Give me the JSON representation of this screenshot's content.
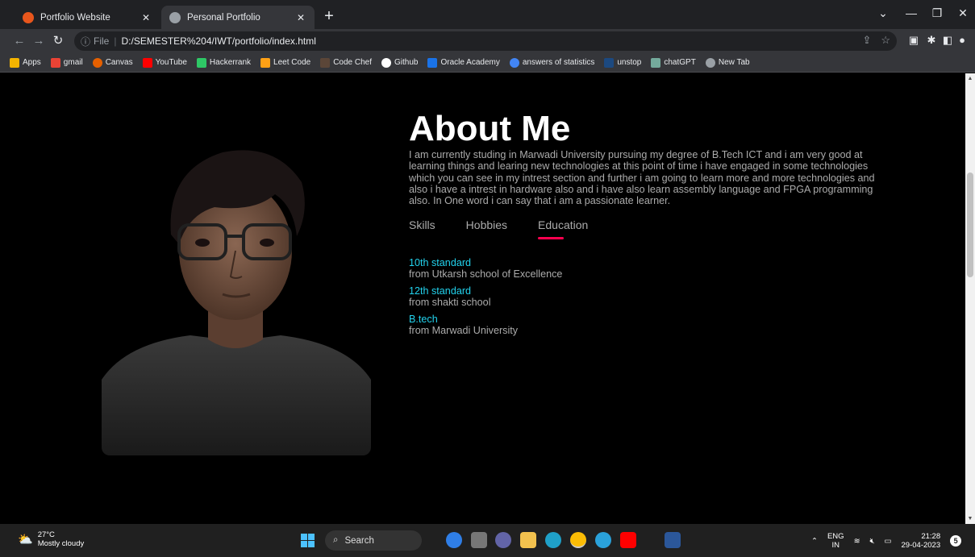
{
  "browser": {
    "tabs": [
      {
        "label": "Portfolio Website",
        "active": false
      },
      {
        "label": "Personal Portfolio",
        "active": true
      }
    ],
    "address": {
      "scheme_label": "File",
      "url": "D:/SEMESTER%204/IWT/portfolio/index.html"
    },
    "bookmarks": [
      {
        "label": "Apps",
        "color": "#f4b400"
      },
      {
        "label": "gmail",
        "color": "#ea4335"
      },
      {
        "label": "Canvas",
        "color": "#e66000"
      },
      {
        "label": "YouTube",
        "color": "#ff0000"
      },
      {
        "label": "Hackerrank",
        "color": "#2ec866"
      },
      {
        "label": "Leet Code",
        "color": "#ffa116"
      },
      {
        "label": "Code Chef",
        "color": "#5b4638"
      },
      {
        "label": "Github",
        "color": "#ffffff"
      },
      {
        "label": "Oracle Academy",
        "color": "#1a73e8"
      },
      {
        "label": "answers of statistics",
        "color": "#4285f4"
      },
      {
        "label": "unstop",
        "color": "#1c4980"
      },
      {
        "label": "chatGPT",
        "color": "#74aa9c"
      },
      {
        "label": "New Tab",
        "color": "#9aa0a6"
      }
    ]
  },
  "page": {
    "title": "About Me",
    "description": "I am currently studing in Marwadi University pursuing my degree of B.Tech ICT and i am very good at learning things and learing new technologies at this point of time i have engaged in some technologies which you can see in my intrest section and further i am going to learn more and more technologies and also i have a intrest in hardware also and i have also learn assembly language and FPGA programming also. In One word i can say that i am a passionate learner.",
    "tabs": [
      {
        "label": "Skills",
        "active": false
      },
      {
        "label": "Hobbies",
        "active": false
      },
      {
        "label": "Education",
        "active": true
      }
    ],
    "education": [
      {
        "title": "10th standard",
        "sub": "from Utkarsh school of Excellence"
      },
      {
        "title": "12th standard",
        "sub": "from shakti school"
      },
      {
        "title": "B.tech",
        "sub": "from Marwadi University"
      }
    ],
    "accent_color": "#ff004f",
    "highlight_color": "#22d3ee"
  },
  "taskbar": {
    "weather_temp": "27°C",
    "weather_desc": "Mostly cloudy",
    "search_label": "Search",
    "lang_top": "ENG",
    "lang_bottom": "IN",
    "time": "21:28",
    "date": "29-04-2023",
    "notifications": "5"
  }
}
